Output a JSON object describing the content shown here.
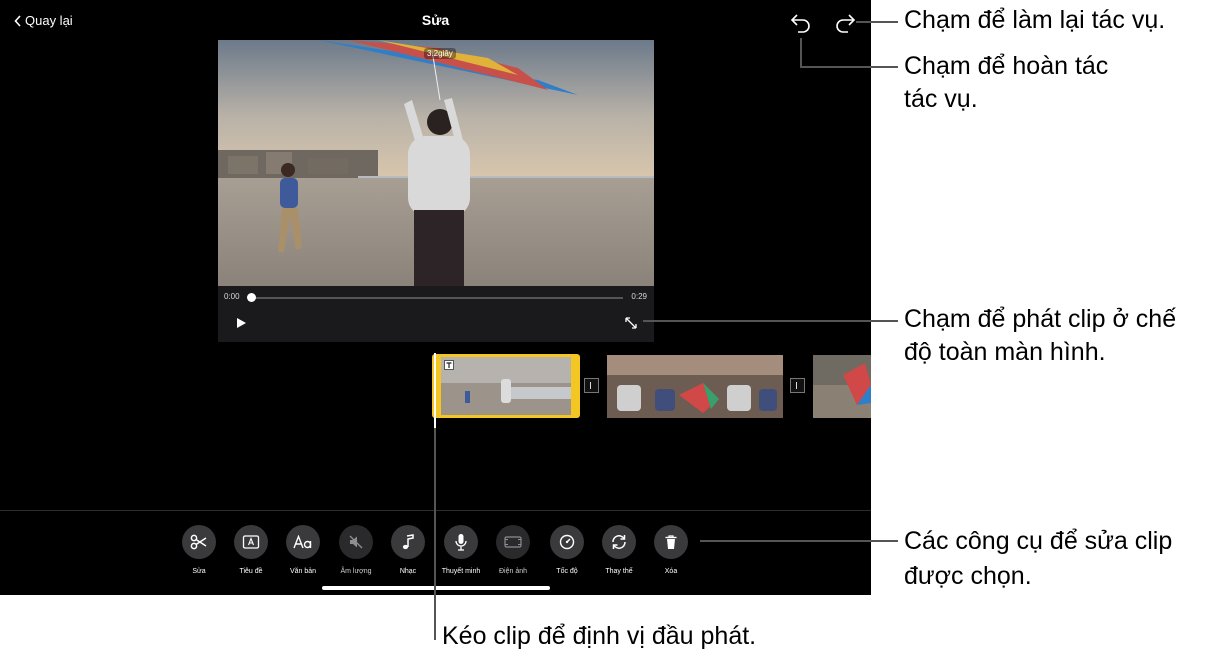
{
  "topbar": {
    "back_label": "Quay lại",
    "title": "Sửa"
  },
  "viewer": {
    "duration_badge": "3.2giây",
    "time_start": "0:00",
    "time_end": "0:29",
    "playback_progress": 0.0
  },
  "toolbar": {
    "tools": [
      {
        "label": "Sửa",
        "icon": "scissors-icon",
        "enabled": true
      },
      {
        "label": "Tiêu đề",
        "icon": "title-icon",
        "enabled": true
      },
      {
        "label": "Văn bản",
        "icon": "text-aa-icon",
        "enabled": true
      },
      {
        "label": "Âm lượng",
        "icon": "volume-muted-icon",
        "enabled": false
      },
      {
        "label": "Nhạc",
        "icon": "music-note-icon",
        "enabled": true
      },
      {
        "label": "Thuyết minh",
        "icon": "microphone-icon",
        "enabled": true
      },
      {
        "label": "Điện ảnh",
        "icon": "cinematic-icon",
        "enabled": false
      },
      {
        "label": "Tốc độ",
        "icon": "speed-gauge-icon",
        "enabled": true
      },
      {
        "label": "Thay thế",
        "icon": "replace-icon",
        "enabled": true
      },
      {
        "label": "Xóa",
        "icon": "trash-icon",
        "enabled": true
      }
    ]
  },
  "callouts": {
    "redo": "Chạm để làm lại tác vụ.",
    "undo_line1": "Chạm để hoàn tác",
    "undo_line2": "tác vụ.",
    "fullscreen_line1": "Chạm để phát clip ở chế",
    "fullscreen_line2": "độ toàn màn hình.",
    "tools_line1": "Các công cụ để sửa clip",
    "tools_line2": "được chọn.",
    "playhead": "Kéo clip để định vị đầu phát."
  },
  "colors": {
    "selection": "#f3c623",
    "background": "#000000",
    "tool_circle": "#3a3a3c"
  }
}
